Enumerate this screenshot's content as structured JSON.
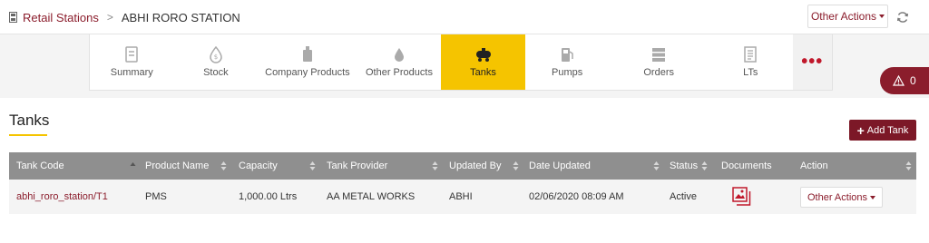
{
  "breadcrumb": {
    "parent": "Retail Stations",
    "separator": ">",
    "current": "ABHI RORO STATION"
  },
  "header_actions": {
    "other_actions": "Other Actions"
  },
  "tabs": [
    {
      "label": "Summary",
      "icon": "summary-icon"
    },
    {
      "label": "Stock",
      "icon": "stock-icon"
    },
    {
      "label": "Company Products",
      "icon": "company-products-icon"
    },
    {
      "label": "Other Products",
      "icon": "other-products-icon"
    },
    {
      "label": "Tanks",
      "icon": "tanks-icon",
      "active": true
    },
    {
      "label": "Pumps",
      "icon": "pumps-icon"
    },
    {
      "label": "Orders",
      "icon": "orders-icon"
    },
    {
      "label": "LTs",
      "icon": "lts-icon"
    }
  ],
  "more_tabs": "•••",
  "alert": {
    "count": "0"
  },
  "section": {
    "title": "Tanks",
    "add_button": "Add Tank"
  },
  "table": {
    "columns": [
      "Tank Code",
      "Product Name",
      "Capacity",
      "Tank Provider",
      "Updated By",
      "Date Updated",
      "Status",
      "Documents",
      "Action"
    ],
    "rows": [
      {
        "tank_code": "abhi_roro_station/T1",
        "product_name": "PMS",
        "capacity": "1,000.00 Ltrs",
        "tank_provider": "AA METAL WORKS",
        "updated_by": "ABHI",
        "date_updated": "02/06/2020 08:09 AM",
        "status": "Active",
        "documents_icon": "image-gallery-icon",
        "action": "Other Actions"
      }
    ]
  },
  "colors": {
    "brand": "#8b1d2c",
    "active_tab": "#f5c400",
    "table_header": "#8f8f8f"
  }
}
